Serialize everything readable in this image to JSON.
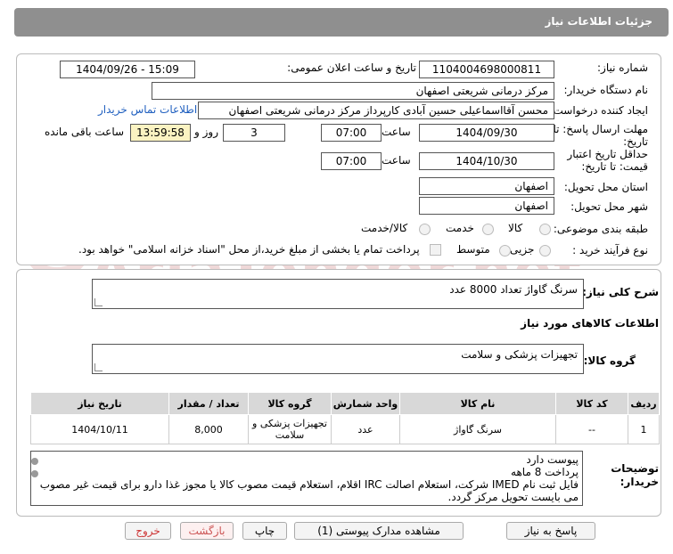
{
  "header": {
    "title": "جزئیات اطلاعات نیاز"
  },
  "watermark": "AriaTender.net",
  "form": {
    "need_number_label": "شماره نیاز:",
    "need_number": "1104004698000811",
    "announce_label": "تاریخ و ساعت اعلان عمومی:",
    "announce_value": "1404/09/26 - 15:09",
    "buyer_org_label": "نام دستگاه خریدار:",
    "buyer_org": "مرکز درمانی شریعتی اصفهان",
    "requester_label": "ایجاد کننده درخواست:",
    "requester": "محسن آقااسماعیلی حسین آبادی کارپرداز مرکز درمانی شریعتی اصفهان",
    "contact_link": "اطلاعات تماس خریدار",
    "deadline_label_1": "مهلت ارسال پاسخ: تا",
    "deadline_label_2": "تاریخ:",
    "deadline_date": "1404/09/30",
    "time_label": "ساعت",
    "deadline_time": "07:00",
    "days_value": "3",
    "days_label": "روز و",
    "remaining_time": "13:59:58",
    "remaining_label": "ساعت باقی مانده",
    "validity_label_1": "حداقل تاریخ اعتبار",
    "validity_label_2": "قیمت: تا تاریخ:",
    "validity_date": "1404/10/30",
    "validity_time": "07:00",
    "province_label": "استان محل تحویل:",
    "province": "اصفهان",
    "city_label": "شهر محل تحویل:",
    "city": "اصفهان",
    "category_label": "طبقه بندی موضوعی:",
    "category_options": [
      "کالا",
      "خدمت",
      "کالا/خدمت"
    ],
    "process_label": "نوع فرآیند خرید :",
    "process_options": [
      "جزیی",
      "متوسط"
    ],
    "payment_note": "پرداخت تمام یا بخشی از مبلغ خرید،از محل \"اسناد خزانه اسلامی\" خواهد بود."
  },
  "details": {
    "summary_label": "شرح کلی نیاز:",
    "summary": "سرنگ گاواژ تعداد 8000 عدد",
    "goods_info_title": "اطلاعات کالاهای مورد نیاز",
    "group_label": "گروه کالا:",
    "group": "تجهیزات پزشکی و سلامت",
    "table": {
      "headers": [
        "ردیف",
        "کد کالا",
        "نام کالا",
        "واحد شمارش",
        "گروه کالا",
        "تعداد / مقدار",
        "تاریخ نیاز"
      ],
      "rows": [
        [
          "1",
          "--",
          "سرنگ گاواژ",
          "عدد",
          "تجهیزات پزشکی و سلامت",
          "8,000",
          "1404/10/11"
        ]
      ]
    },
    "notes_label_1": "توضیحات",
    "notes_label_2": "خریدار:",
    "notes_lines": [
      "پیوست دارد",
      "پرداخت 8 ماهه",
      "فایل ثبت نام IMED شرکت، استعلام اصالت IRC اقلام، استعلام قیمت مصوب کالا یا مجوز غذا دارو برای قیمت غیر مصوب",
      "می بایست تحویل مرکز گردد."
    ]
  },
  "buttons": {
    "reply": "پاسخ به نیاز",
    "attachments": "مشاهده مدارک پیوستی (1)",
    "print": "چاپ",
    "back": "بازگشت",
    "exit": "خروج"
  }
}
